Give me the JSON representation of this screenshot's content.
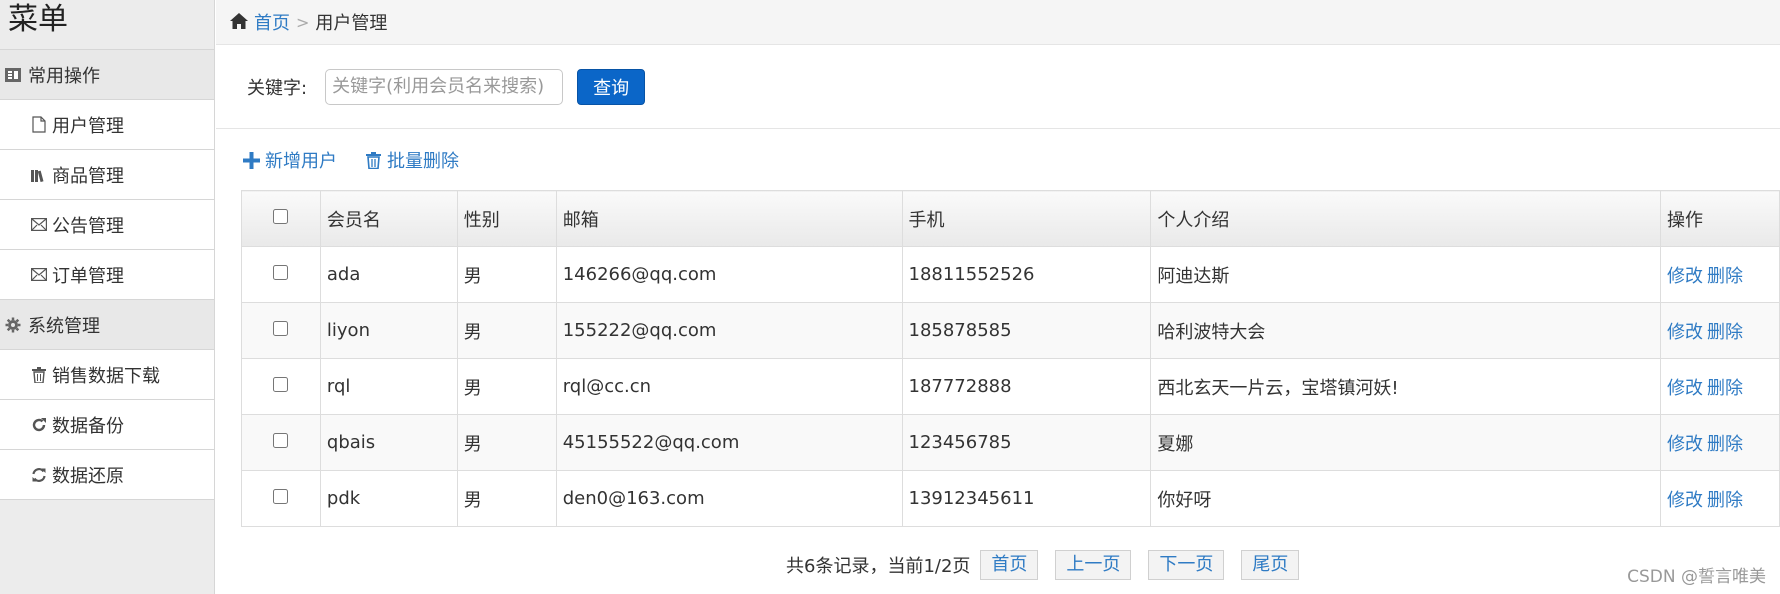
{
  "sidebar": {
    "title": "菜单",
    "groups": [
      {
        "label": "常用操作",
        "icon": "list-icon",
        "items": [
          {
            "label": "用户管理",
            "icon": "file-icon"
          },
          {
            "label": "商品管理",
            "icon": "books-icon"
          },
          {
            "label": "公告管理",
            "icon": "envelope-icon"
          },
          {
            "label": "订单管理",
            "icon": "envelope-icon"
          }
        ]
      },
      {
        "label": "系统管理",
        "icon": "gear-icon",
        "items": [
          {
            "label": "销售数据下载",
            "icon": "trash-icon"
          },
          {
            "label": "数据备份",
            "icon": "refresh-icon"
          },
          {
            "label": "数据还原",
            "icon": "sync-icon"
          }
        ]
      }
    ]
  },
  "breadcrumb": {
    "home": "首页",
    "separator": ">",
    "current": "用户管理"
  },
  "search": {
    "label": "关键字:",
    "placeholder": "关键字(利用会员名来搜索)",
    "value": "",
    "button": "查询"
  },
  "toolbar": {
    "add": "新增用户",
    "batch_delete": "批量删除"
  },
  "table": {
    "headers": [
      "会员名",
      "性别",
      "邮箱",
      "手机",
      "个人介绍",
      "操作"
    ],
    "rows": [
      {
        "name": "ada",
        "gender": "男",
        "email": "146266@qq.com",
        "phone": "18811552526",
        "intro": "阿迪达斯",
        "edit": "修改",
        "delete": "删除"
      },
      {
        "name": "liyon",
        "gender": "男",
        "email": "155222@qq.com",
        "phone": "185878585",
        "intro": "哈利波特大会",
        "edit": "修改",
        "delete": "删除"
      },
      {
        "name": "rql",
        "gender": "男",
        "email": "rql@cc.cn",
        "phone": "187772888",
        "intro": "西北玄天一片云，宝塔镇河妖!",
        "edit": "修改",
        "delete": "删除"
      },
      {
        "name": "qbais",
        "gender": "男",
        "email": "45155522@qq.com",
        "phone": "123456785",
        "intro": "夏娜",
        "edit": "修改",
        "delete": "删除"
      },
      {
        "name": "pdk",
        "gender": "男",
        "email": "den0@163.com",
        "phone": "13912345611",
        "intro": "你好呀",
        "edit": "修改",
        "delete": "删除"
      }
    ]
  },
  "pager": {
    "info": "共6条记录，当前1/2页",
    "first": "首页",
    "prev": "上一页",
    "next": "下一页",
    "last": "尾页"
  },
  "watermark": "CSDN @誓言唯美",
  "colors": {
    "link": "#2f7bc4",
    "primary_button": "#0b66c8",
    "sidebar_bg": "#ececec"
  }
}
